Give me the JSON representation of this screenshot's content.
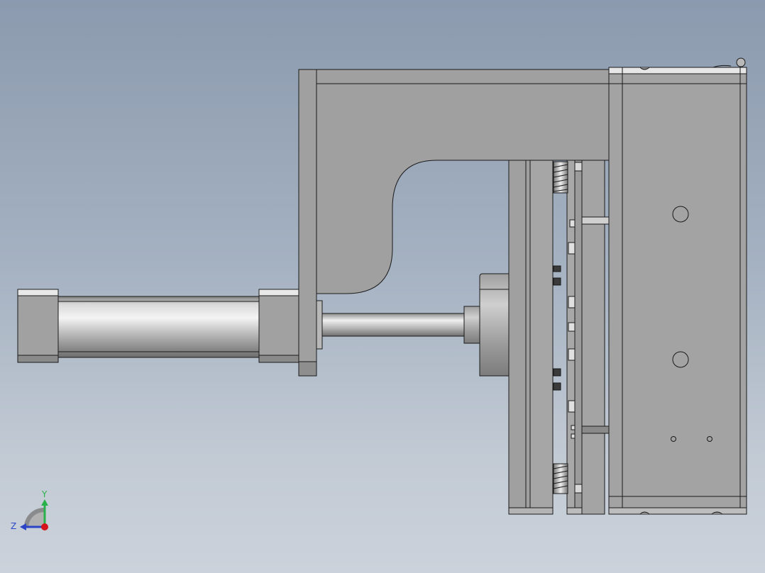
{
  "viewport": {
    "background_top": "#8b9aae",
    "background_bottom": "#cbd2db",
    "part_fill": "#9d9d9d",
    "part_face_fill": "#a2a2a2",
    "edge_color": "#1a1a1a"
  },
  "triad": {
    "y_label": "Y",
    "z_label": "Z",
    "y_color": "#2bb14a",
    "z_color": "#2c44c8",
    "x_color": "#d4161c"
  }
}
